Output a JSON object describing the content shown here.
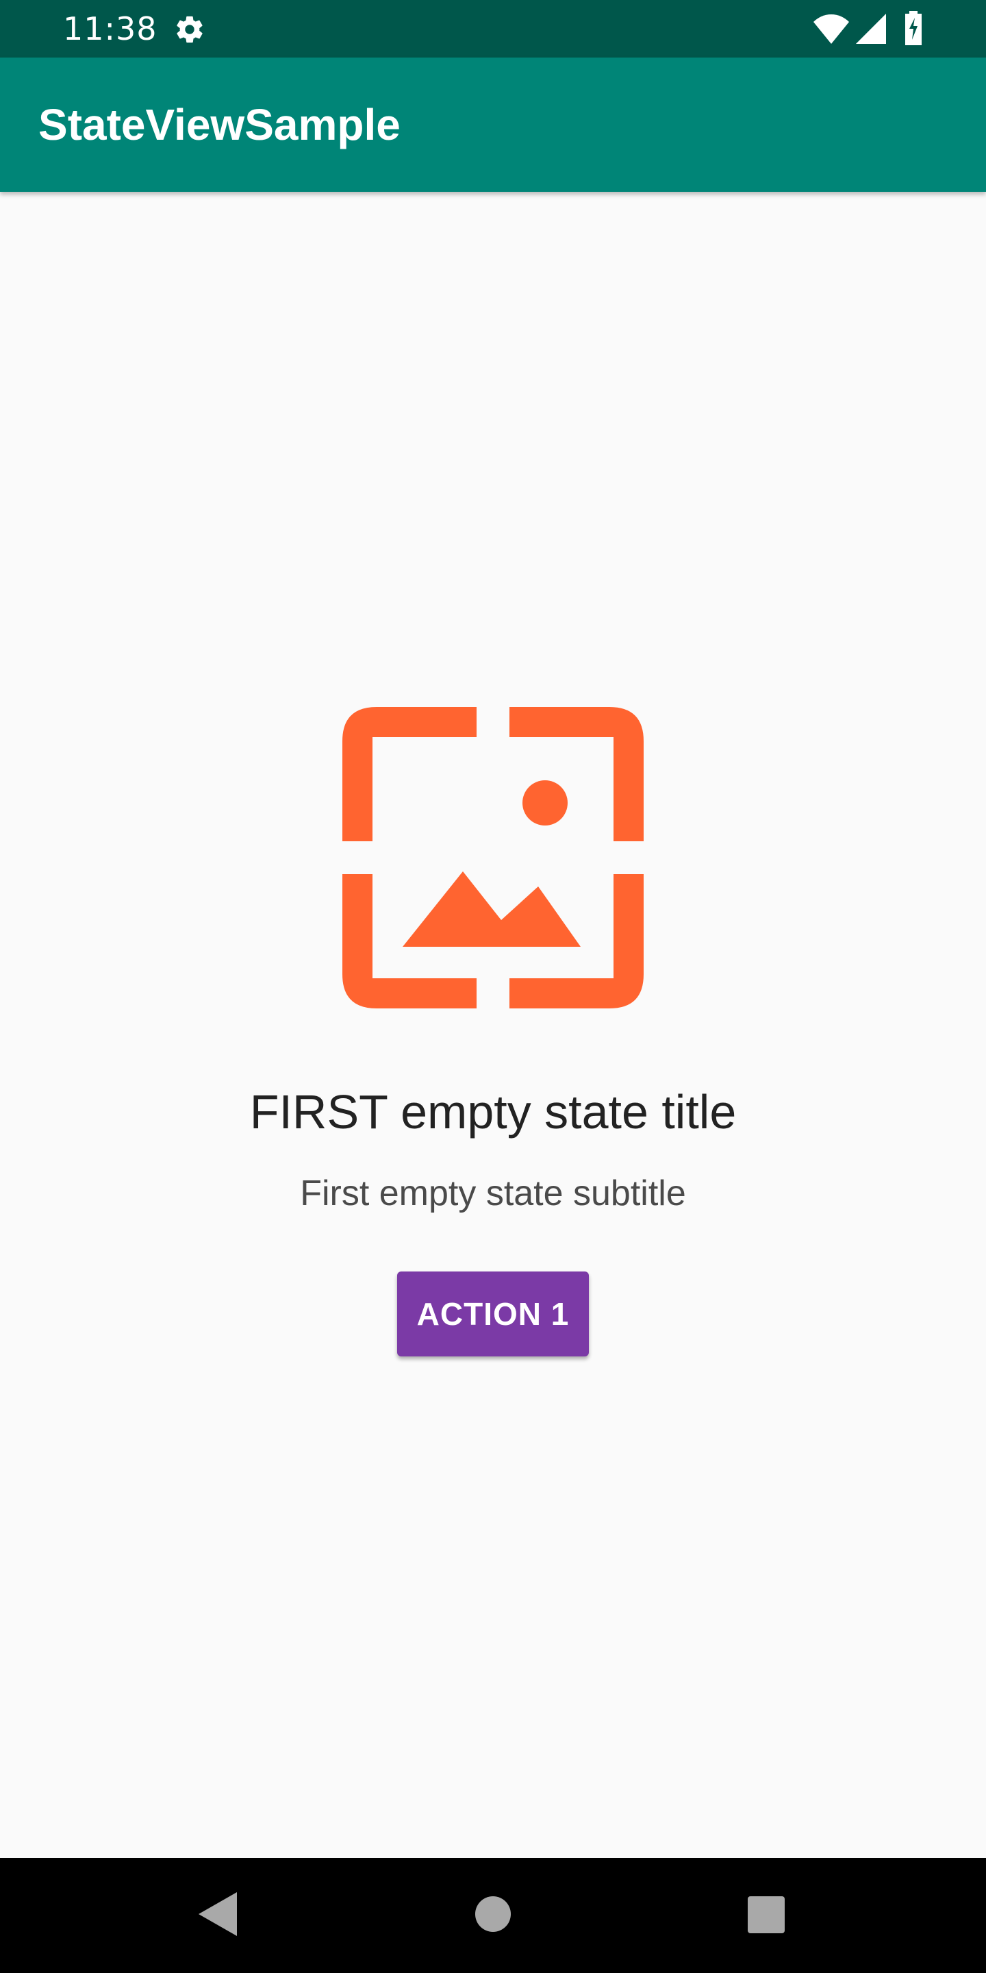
{
  "status_bar": {
    "time": "11:38",
    "icons": [
      "gear-icon",
      "wifi-icon",
      "cell-signal-icon",
      "battery-charging-icon"
    ]
  },
  "app_bar": {
    "title": "StateViewSample",
    "color": "#008577"
  },
  "empty_state": {
    "icon": "image-placeholder-icon",
    "icon_color": "#ff6430",
    "title": "FIRST empty state title",
    "subtitle": "First empty state subtitle",
    "action_label": "ACTION 1",
    "action_color": "#7b3aa6"
  },
  "nav_bar": {
    "buttons": [
      "back-icon",
      "home-icon",
      "recents-icon"
    ]
  }
}
